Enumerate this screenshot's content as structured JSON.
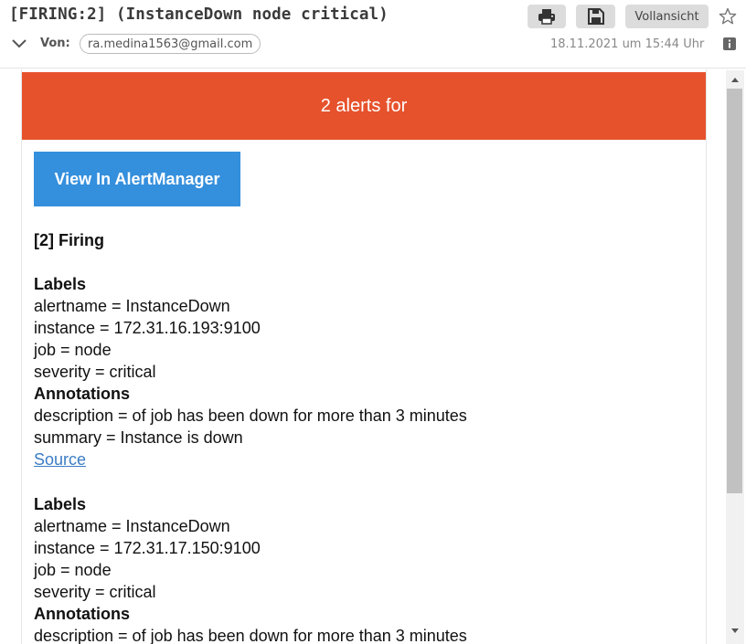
{
  "header": {
    "subject": "[FIRING:2] (InstanceDown node critical)",
    "print_icon": "printer-icon",
    "save_icon": "floppy-disk-icon",
    "full_view_label": "Vollansicht",
    "star_icon": "star-icon",
    "from_label": "Von:",
    "from_address": "ra.medina1563@gmail.com",
    "date": "18.11.2021 um 15:44 Uhr",
    "info_icon": "info-icon"
  },
  "email": {
    "banner_text": "2 alerts for",
    "banner_color": "#e6522c",
    "button_label": "View In AlertManager",
    "button_color": "#348fdd",
    "firing_heading": "[2] Firing",
    "alerts": [
      {
        "labels_heading": "Labels",
        "alertname": "alertname = InstanceDown",
        "instance": "instance = 172.31.16.193:9100",
        "job": "job = node",
        "severity": "severity = critical",
        "annotations_heading": "Annotations",
        "description": "description = of job has been down for more than 3 minutes",
        "summary": "summary = Instance is down",
        "source_link": "Source"
      },
      {
        "labels_heading": "Labels",
        "alertname": "alertname = InstanceDown",
        "instance": "instance = 172.31.17.150:9100",
        "job": "job = node",
        "severity": "severity = critical",
        "annotations_heading": "Annotations",
        "description": "description = of job has been down for more than 3 minutes"
      }
    ]
  }
}
